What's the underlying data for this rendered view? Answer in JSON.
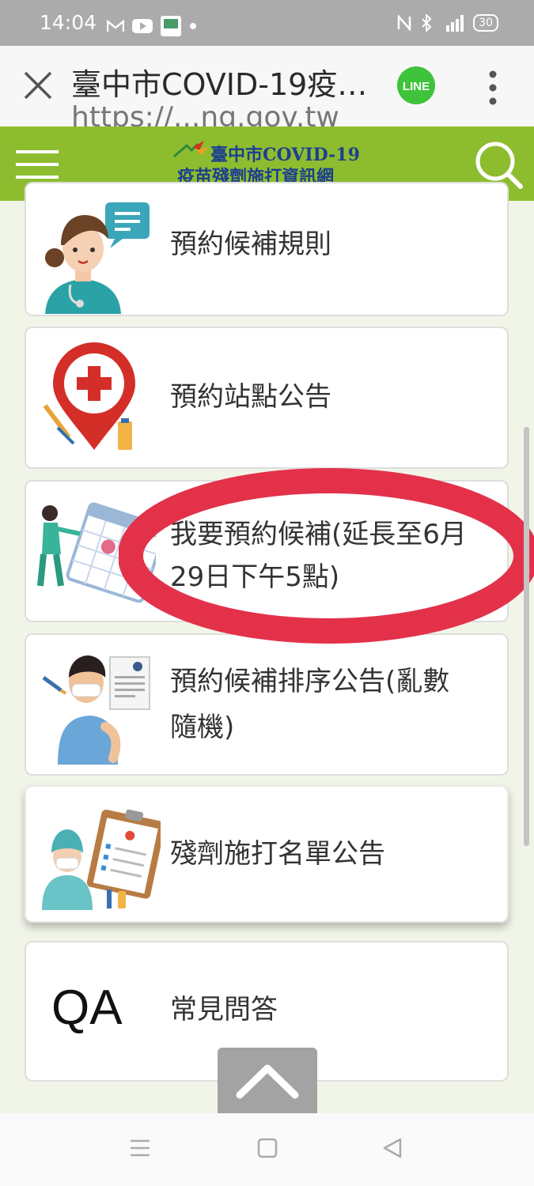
{
  "status_bar": {
    "time": "14:04",
    "battery": "30",
    "icons": [
      "gmail-icon",
      "youtube-icon",
      "app-icon",
      "dot-icon",
      "nfc-icon",
      "bluetooth-icon",
      "signal-4g-icon",
      "battery-icon"
    ]
  },
  "browser": {
    "title": "臺中市COVID-19疫…",
    "url": "https://...ng.gov.tw",
    "line_label": "LINE"
  },
  "site_header": {
    "logo_line1": "臺中市COVID-19",
    "logo_line2": "疫苗殘劑施打資訊網",
    "color": "#8dbd2f"
  },
  "menu": [
    {
      "label": "預約候補規則",
      "icon": "nurse-chat-icon"
    },
    {
      "label": "預約站點公告",
      "icon": "map-pin-medical-icon"
    },
    {
      "label_line1": "我要預約候補(延長至6月",
      "label_line2": "29日下午5點)",
      "icon": "calendar-nurse-icon"
    },
    {
      "label_line1": "預約候補排序公告(亂數",
      "label_line2": "隨機)",
      "icon": "vaccinated-person-icon"
    },
    {
      "label": "殘劑施打名單公告",
      "icon": "clipboard-nurse-icon"
    },
    {
      "label": "常見問答",
      "icon_text": "QA"
    }
  ],
  "highlight_color": "#e3314a"
}
